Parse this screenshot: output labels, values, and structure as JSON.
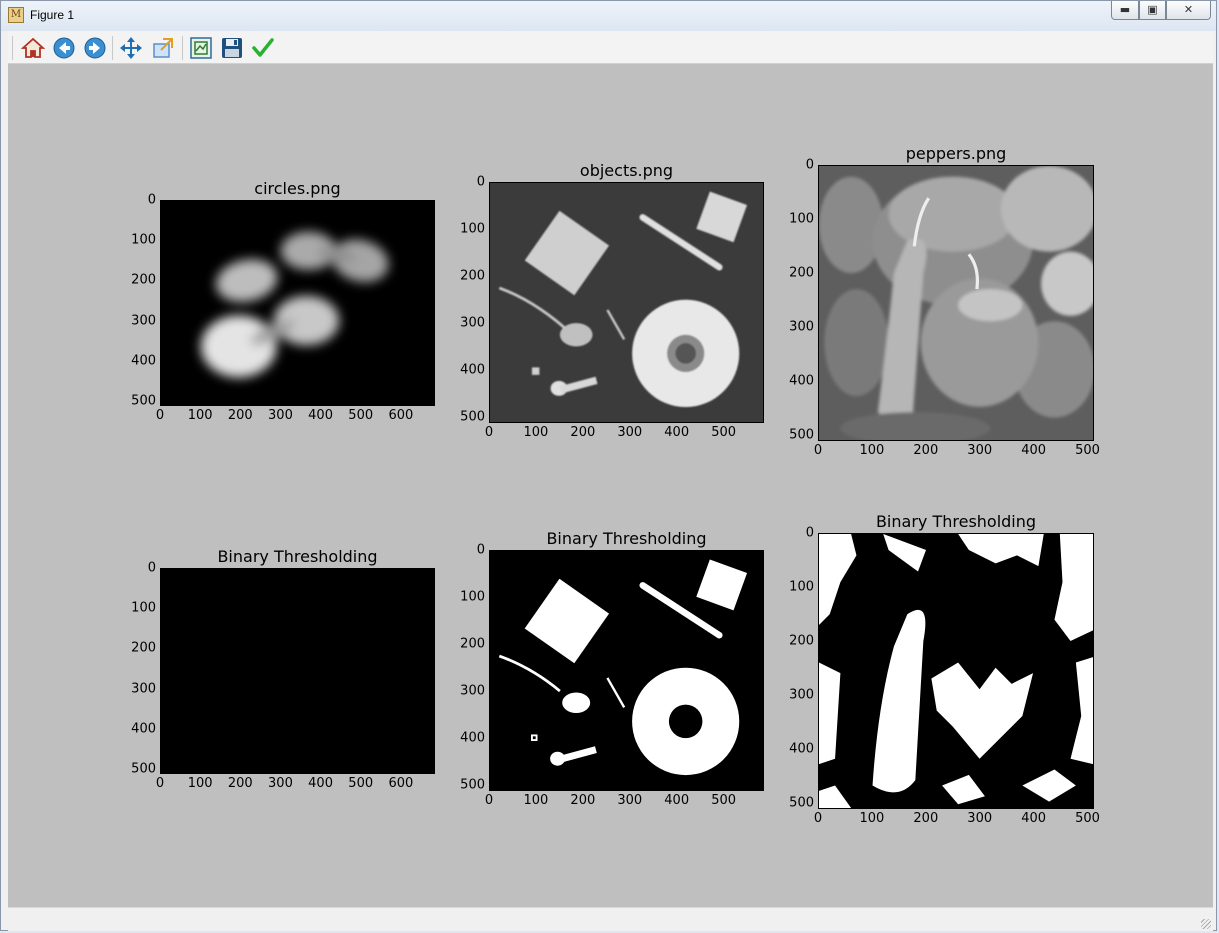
{
  "window": {
    "title": "Figure 1",
    "app_icon": "matplotlib-icon"
  },
  "controls": {
    "minimize": "minimize-icon",
    "maximize": "maximize-icon",
    "close": "close-icon"
  },
  "toolbar": [
    {
      "name": "home-icon",
      "color": "#c0392b"
    },
    {
      "name": "back-arrow-icon",
      "color": "#2b7fc0"
    },
    {
      "name": "forward-arrow-icon",
      "color": "#2b7fc0"
    },
    {
      "name": "pan-move-icon",
      "color": "#1f6fb0"
    },
    {
      "name": "zoom-to-rect-icon",
      "color": "#5a8fcb"
    },
    {
      "name": "configure-subplots-icon",
      "color": "#2e7d32"
    },
    {
      "name": "save-figure-icon",
      "color": "#1f4f7a"
    },
    {
      "name": "edit-checkmark-icon",
      "color": "#29b12f"
    }
  ],
  "figure": {
    "background": "#bfbfbf"
  },
  "plots": [
    {
      "title": "circles.png",
      "yticks": [
        "0",
        "100",
        "200",
        "300",
        "400",
        "500"
      ],
      "xticks": [
        "0",
        "100",
        "200",
        "300",
        "400",
        "500",
        "600"
      ],
      "image": "blurred-circles-grayscale",
      "xlim": [
        0,
        685
      ],
      "ylim": [
        512,
        0
      ]
    },
    {
      "title": "objects.png",
      "yticks": [
        "0",
        "100",
        "200",
        "300",
        "400",
        "500"
      ],
      "xticks": [
        "0",
        "100",
        "200",
        "300",
        "400",
        "500"
      ],
      "image": "objects-grayscale",
      "xlim": [
        0,
        586
      ],
      "ylim": [
        512,
        0
      ]
    },
    {
      "title": "peppers.png",
      "yticks": [
        "0",
        "100",
        "200",
        "300",
        "400",
        "500"
      ],
      "xticks": [
        "0",
        "100",
        "200",
        "300",
        "400",
        "500"
      ],
      "image": "peppers-grayscale",
      "xlim": [
        0,
        512
      ],
      "ylim": [
        512,
        0
      ]
    },
    {
      "title": "Binary Thresholding",
      "yticks": [
        "0",
        "100",
        "200",
        "300",
        "400",
        "500"
      ],
      "xticks": [
        "0",
        "100",
        "200",
        "300",
        "400",
        "500",
        "600"
      ],
      "image": "circles-binary",
      "xlim": [
        0,
        685
      ],
      "ylim": [
        512,
        0
      ]
    },
    {
      "title": "Binary Thresholding",
      "yticks": [
        "0",
        "100",
        "200",
        "300",
        "400",
        "500"
      ],
      "xticks": [
        "0",
        "100",
        "200",
        "300",
        "400",
        "500"
      ],
      "image": "objects-binary",
      "xlim": [
        0,
        586
      ],
      "ylim": [
        512,
        0
      ]
    },
    {
      "title": "Binary Thresholding",
      "yticks": [
        "0",
        "100",
        "200",
        "300",
        "400",
        "500"
      ],
      "xticks": [
        "0",
        "100",
        "200",
        "300",
        "400",
        "500"
      ],
      "image": "peppers-binary",
      "xlim": [
        0,
        512
      ],
      "ylim": [
        512,
        0
      ]
    }
  ]
}
